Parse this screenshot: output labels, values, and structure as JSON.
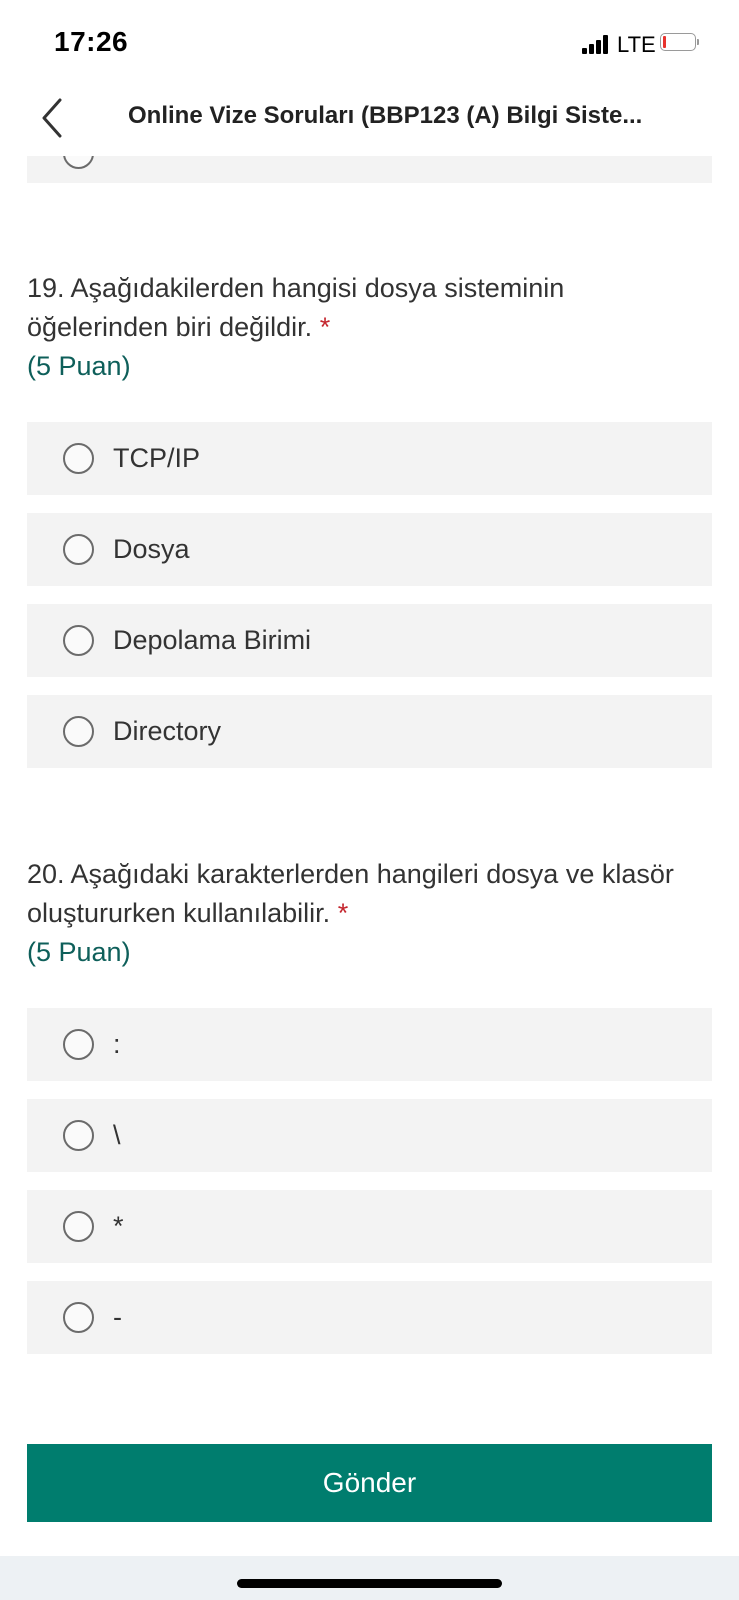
{
  "status_bar": {
    "time": "17:26",
    "network": "LTE",
    "battery_level": 0.1,
    "battery_color": "#e8332e"
  },
  "header": {
    "title": "Online Vize Soruları (BBP123 (A) Bilgi Siste...",
    "back_icon": "chevron-left-icon"
  },
  "questions": [
    {
      "text": "19. Aşağıdakilerden hangisi dosya sisteminin öğelerinden biri değildir.",
      "required_mark": "*",
      "points": "(5 Puan)",
      "options": [
        "TCP/IP",
        "Dosya",
        "Depolama Birimi",
        "Directory"
      ]
    },
    {
      "text": "20. Aşağıdaki karakterlerden hangileri dosya ve klasör oluştururken kullanılabilir.",
      "required_mark": "*",
      "points": "(5 Puan)",
      "options": [
        ":",
        "\\",
        "*",
        "-"
      ]
    }
  ],
  "submit": {
    "label": "Gönder"
  },
  "colors": {
    "accent": "#007d6e",
    "points_text": "#0e5f5a",
    "required": "#c4262e",
    "option_bg": "#f3f3f3"
  }
}
